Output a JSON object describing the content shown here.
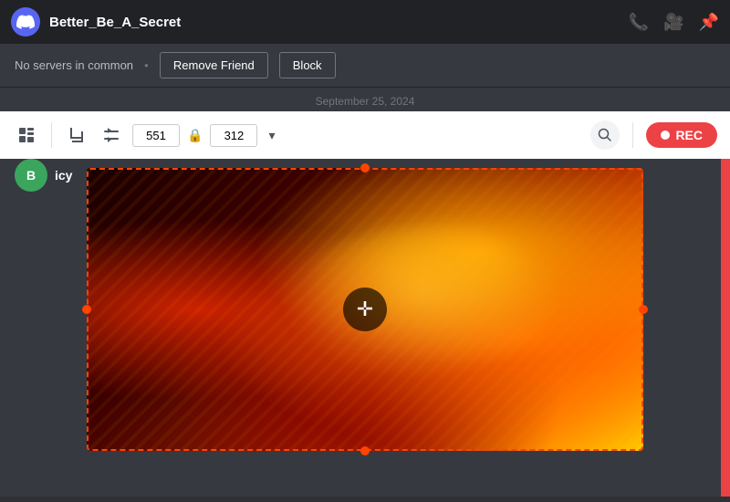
{
  "titleBar": {
    "username": "Better_Be_A_Secret",
    "icons": [
      "phone-icon",
      "video-icon",
      "pin-icon"
    ]
  },
  "subHeader": {
    "no_servers_label": "No servers in common",
    "remove_friend_label": "Remove Friend",
    "block_label": "Block"
  },
  "dateSeparator": {
    "label": "September 25, 2024"
  },
  "toolbar": {
    "width_value": "551",
    "height_value": "312",
    "rec_label": "REC",
    "search_placeholder": ""
  },
  "content": {
    "avatar_initial": "B",
    "username_label": "icy"
  },
  "accents": {
    "red": "#ed4245",
    "orange": "#ff4400",
    "blurple": "#5865f2"
  }
}
